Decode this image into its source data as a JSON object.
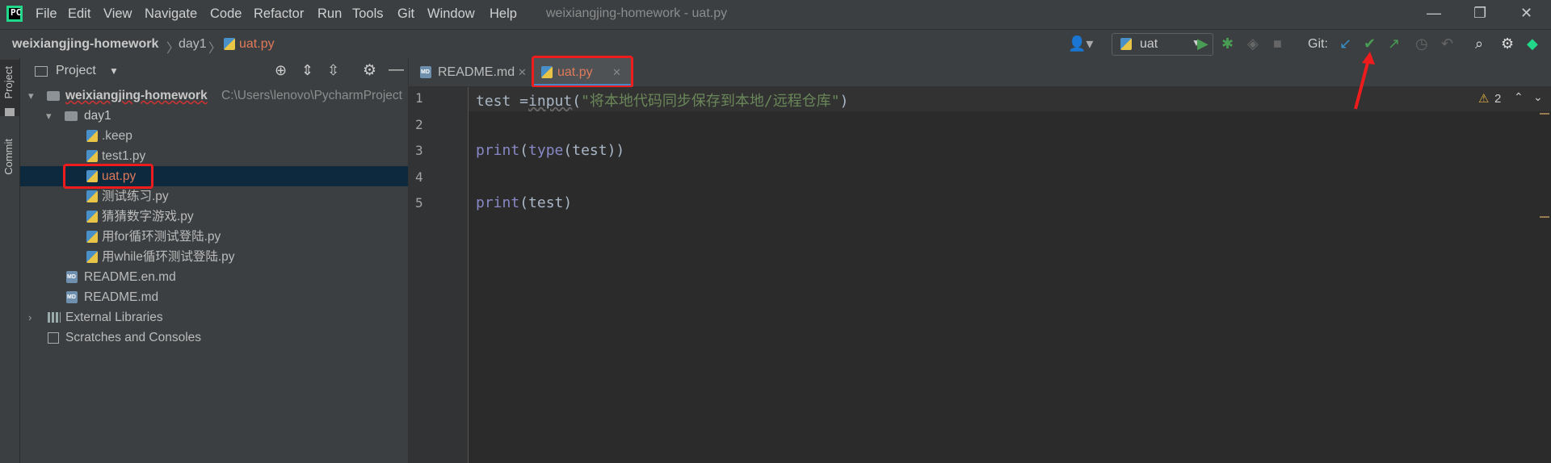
{
  "menu": {
    "items": [
      "File",
      "Edit",
      "View",
      "Navigate",
      "Code",
      "Refactor",
      "Run",
      "Tools",
      "Git",
      "Window",
      "Help"
    ],
    "window_title": "weixiangjing-homework - uat.py"
  },
  "navbar": {
    "breadcrumb": [
      "weixiangjing-homework",
      "day1",
      "uat.py"
    ],
    "run_config": "uat",
    "git_label": "Git:"
  },
  "sidebar": {
    "tabs": [
      "Project",
      "Commit"
    ]
  },
  "project_panel": {
    "title": "Project",
    "root": {
      "name": "weixiangjing-homework",
      "path": "C:\\Users\\lenovo\\PycharmProject"
    },
    "folder": "day1",
    "files": [
      ".keep",
      "test1.py",
      "uat.py",
      "测试练习.py",
      "猜猜数字游戏.py",
      "用for循环测试登陆.py",
      "用while循环测试登陆.py"
    ],
    "root_files": [
      "README.en.md",
      "README.md"
    ],
    "external": "External Libraries",
    "scratches": "Scratches and Consoles",
    "md_icon_text": "MD"
  },
  "editor": {
    "tabs": [
      "README.md",
      "uat.py"
    ],
    "active_tab": "uat.py",
    "line_numbers": [
      "1",
      "2",
      "3",
      "4",
      "5"
    ],
    "warnings_count": "2",
    "code": {
      "l1_var": "test =",
      "l1_fn": "input",
      "l1_open": "(",
      "l1_str": "\"将本地代码同步保存到本地/远程仓库\"",
      "l1_close": ")",
      "l3_print": "print",
      "l3_open": "(",
      "l3_type": "type",
      "l3_rest": "(test))",
      "l5_print": "print",
      "l5_rest": "(test)"
    }
  },
  "colors": {
    "run_green": "#499c54",
    "git_blue": "#3592c4",
    "highlight_red": "#ee1c1c"
  }
}
